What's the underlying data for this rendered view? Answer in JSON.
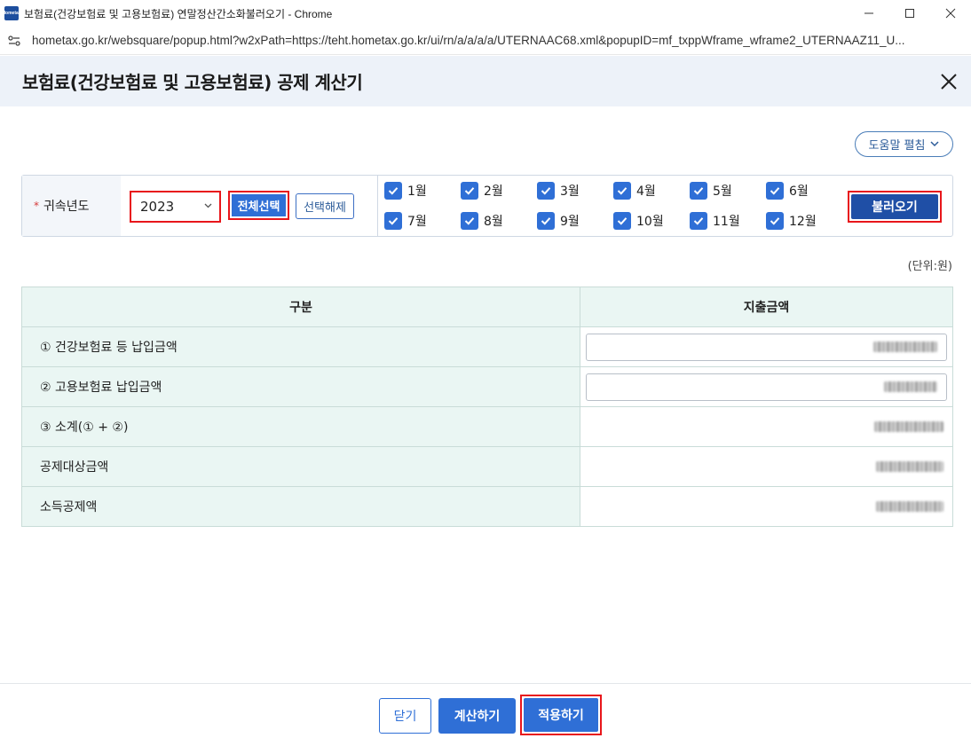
{
  "window": {
    "title": "보험료(건강보험료 및 고용보험료) 연말정산간소화불러오기 - Chrome",
    "app_icon_text": "Hometax",
    "url": "hometax.go.kr/websquare/popup.html?w2xPath=https://teht.hometax.go.kr/ui/rn/a/a/a/a/UTERNAAC68.xml&popupID=mf_txppWframe_wframe2_UTERNAAZ11_U..."
  },
  "popup": {
    "title": "보험료(건강보험료 및 고용보험료) 공제 계산기",
    "help_label": "도움말 펼침"
  },
  "filter": {
    "required_mark": "*",
    "year_label": "귀속년도",
    "year_value": "2023",
    "select_all_label": "전체선택",
    "deselect_label": "선택해제",
    "load_label": "불러오기",
    "months": [
      {
        "label": "1월",
        "checked": true
      },
      {
        "label": "2월",
        "checked": true
      },
      {
        "label": "3월",
        "checked": true
      },
      {
        "label": "4월",
        "checked": true
      },
      {
        "label": "5월",
        "checked": true
      },
      {
        "label": "6월",
        "checked": true
      },
      {
        "label": "7월",
        "checked": true
      },
      {
        "label": "8월",
        "checked": true
      },
      {
        "label": "9월",
        "checked": true
      },
      {
        "label": "10월",
        "checked": true
      },
      {
        "label": "11월",
        "checked": true
      },
      {
        "label": "12월",
        "checked": true
      }
    ]
  },
  "table": {
    "unit": "(단위:원)",
    "headers": [
      "구분",
      "지출금액"
    ],
    "rows": [
      {
        "label": "① 건강보험료 등 납입금액"
      },
      {
        "label": "② 고용보험료 납입금액"
      },
      {
        "label": "③ 소계(① + ②)"
      },
      {
        "label": "공제대상금액"
      },
      {
        "label": "소득공제액"
      }
    ]
  },
  "footer": {
    "close_label": "닫기",
    "calc_label": "계산하기",
    "apply_label": "적용하기"
  },
  "colors": {
    "primary": "#2f6fd6",
    "load_button": "#1f4fa6",
    "highlight_border": "#e8161b",
    "header_band": "#edf2f9",
    "table_header": "#eaf6f3"
  }
}
